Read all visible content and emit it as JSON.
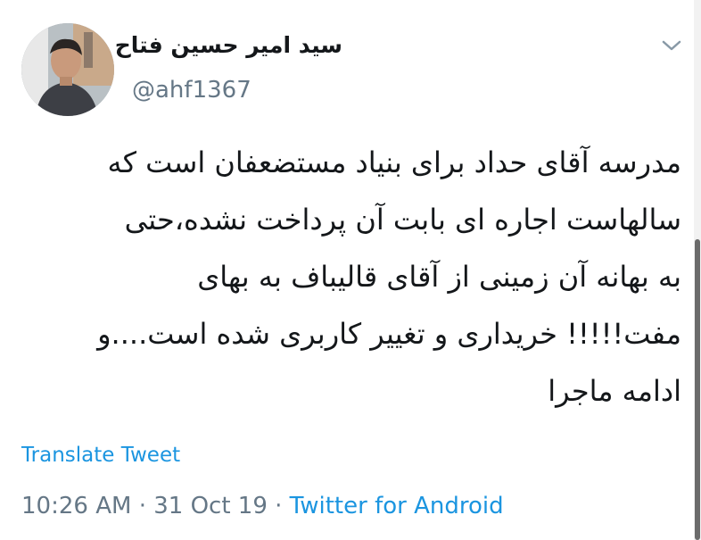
{
  "tweet": {
    "display_name": "سید امیر حسین فتاح",
    "handle": "@ahf1367",
    "text_lines": [
      "مدرسه آقای حداد برای بنیاد مستضعفان است که",
      "سالهاست اجاره ای بابت آن پرداخت نشده،حتی",
      "به بهانه آن زمینی از آقای قالیباف به بهای",
      "مفت!!!!! خریداری و تغییر کاربری شده است....و",
      "ادامه ماجرا"
    ],
    "translate_label": "Translate Tweet",
    "time": "10:26 AM",
    "separator": "·",
    "date": "31 Oct 19",
    "source": "Twitter for Android"
  },
  "icons": {
    "menu": "chevron-down-icon",
    "avatar": "avatar-photo"
  },
  "colors": {
    "text": "#14171a",
    "secondary": "#657786",
    "link": "#1b95e0"
  }
}
